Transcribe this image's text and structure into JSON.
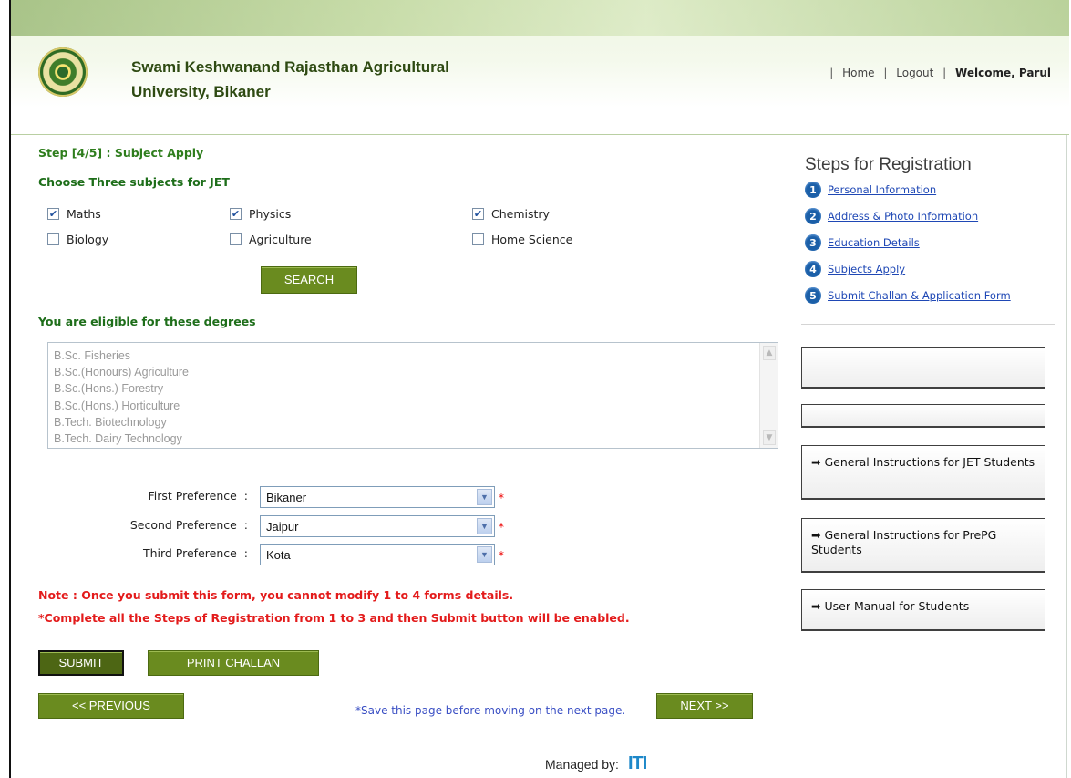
{
  "header": {
    "university_line1": "Swami Keshwanand Rajasthan Agricultural",
    "university_line2": "University, Bikaner",
    "home_link": "Home",
    "logout_link": "Logout",
    "welcome": "Welcome, Parul",
    "separator": "|"
  },
  "form": {
    "step_title": "Step [4/5] : Subject Apply",
    "choose_title": "Choose Three subjects for JET",
    "subjects": [
      {
        "label": "Maths",
        "checked": true
      },
      {
        "label": "Physics",
        "checked": true
      },
      {
        "label": "Chemistry",
        "checked": true
      },
      {
        "label": "Biology",
        "checked": false
      },
      {
        "label": "Agriculture",
        "checked": false
      },
      {
        "label": "Home Science",
        "checked": false
      }
    ],
    "search_button": "SEARCH",
    "eligible_title": "You are eligible for these degrees",
    "degrees": [
      "B.Sc. Fisheries",
      "B.Sc.(Honours) Agriculture",
      "B.Sc.(Hons.) Forestry",
      "B.Sc.(Hons.) Horticulture",
      "B.Tech. Biotechnology",
      "B.Tech. Dairy Technology"
    ],
    "preferences": [
      {
        "label": "First Preference",
        "value": "Bikaner"
      },
      {
        "label": "Second Preference",
        "value": "Jaipur"
      },
      {
        "label": "Third Preference",
        "value": "Kota"
      }
    ],
    "pref_colon": ":",
    "required_mark": "*",
    "note1": "Note : Once you submit this form, you cannot modify 1 to 4 forms details.",
    "note2": "*Complete all the Steps of Registration from 1 to 3 and then Submit button will be enabled.",
    "submit_button": "SUBMIT",
    "print_button": "PRINT CHALLAN",
    "previous_button": "<< PREVIOUS",
    "next_button": "NEXT >>",
    "save_note": "*Save this page before moving on the next page."
  },
  "sidebar": {
    "title": "Steps for Registration",
    "steps": [
      {
        "num": "1",
        "label": "Personal Information"
      },
      {
        "num": "2",
        "label": "Address & Photo Information"
      },
      {
        "num": "3",
        "label": "Education Details"
      },
      {
        "num": "4",
        "label": "Subjects Apply"
      },
      {
        "num": "5",
        "label": "Submit Challan & Application Form"
      }
    ],
    "panels": [
      "General Instructions for JET Students",
      "General Instructions for PrePG Students",
      "User Manual for Students"
    ]
  },
  "footer": {
    "managed_by": "Managed by:",
    "logo_text": "ITI"
  },
  "colors": {
    "accent_green": "#6a8b1f",
    "title_green": "#1e6e1a",
    "note_red": "#e31b1b",
    "link_blue": "#1f48b5",
    "step_badge_blue": "#1b5fa8"
  }
}
